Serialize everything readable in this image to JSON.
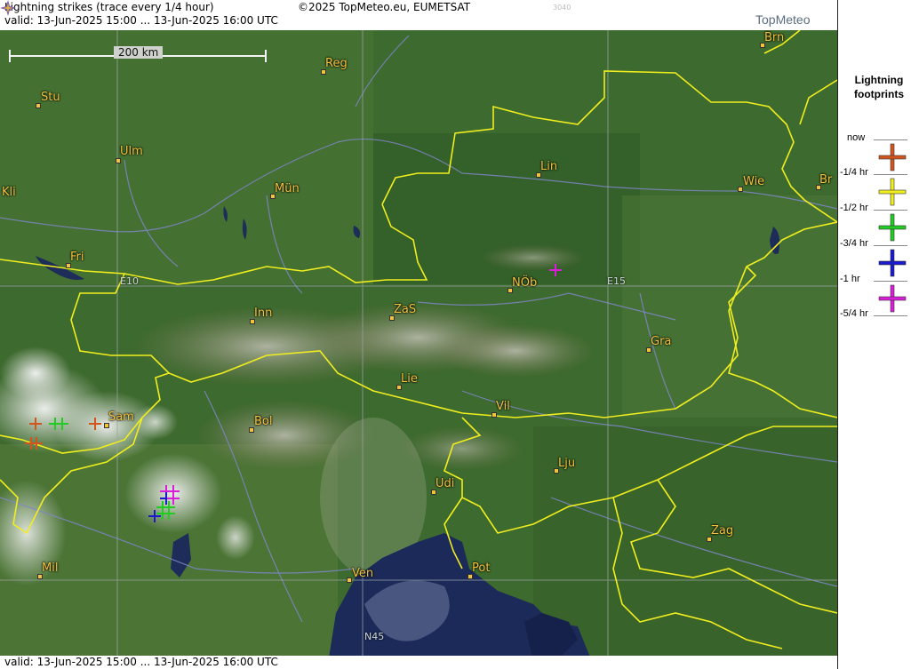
{
  "header": {
    "title": "Lightning strikes (trace every 1/4 hour)",
    "valid": "valid:  13-Jun-2025 15:00 ... 13-Jun-2025 16:00 UTC",
    "copyright": "©2025 TopMeteo.eu, EUMETSAT",
    "code": "3040",
    "logo": "TopMeteo"
  },
  "footer": {
    "valid": "valid:  13-Jun-2025 15:00 ... 13-Jun-2025 16:00 UTC"
  },
  "scale": {
    "label": "200 km"
  },
  "grid_labels": {
    "e10": "E10",
    "e15": "E15",
    "n45": "N45"
  },
  "cities": [
    {
      "code": "Brn"
    },
    {
      "code": "Reg"
    },
    {
      "code": "Stu"
    },
    {
      "code": "Ulm"
    },
    {
      "code": "Lin"
    },
    {
      "code": "Kli"
    },
    {
      "code": "Mün"
    },
    {
      "code": "Wie"
    },
    {
      "code": "Br"
    },
    {
      "code": "Fri"
    },
    {
      "code": "NÖb"
    },
    {
      "code": "Inn"
    },
    {
      "code": "ZaS"
    },
    {
      "code": "Gra"
    },
    {
      "code": "Lie"
    },
    {
      "code": "Sam"
    },
    {
      "code": "Vil"
    },
    {
      "code": "Bol"
    },
    {
      "code": "Lju"
    },
    {
      "code": "Udi"
    },
    {
      "code": "Zag"
    },
    {
      "code": "Mil"
    },
    {
      "code": "Pot"
    },
    {
      "code": "Ven"
    }
  ],
  "legend": {
    "title_line1": "Lightning",
    "title_line2": "footprints",
    "items": [
      {
        "label": "now",
        "color": "#d2551e"
      },
      {
        "label": "-1/4 hr",
        "color": "#f0ee1e"
      },
      {
        "label": "-1/2 hr",
        "color": "#22cc22"
      },
      {
        "label": "-3/4 hr",
        "color": "#1a1acc"
      },
      {
        "label": "-1 hr",
        "color": "#d81ed8"
      },
      {
        "label": "-5/4 hr",
        "color": ""
      }
    ]
  },
  "strike_colors": {
    "now": "#d2551e",
    "q1": "#f0ee1e",
    "q2": "#22cc22",
    "q3": "#1a1acc",
    "q4": "#d81ed8"
  }
}
